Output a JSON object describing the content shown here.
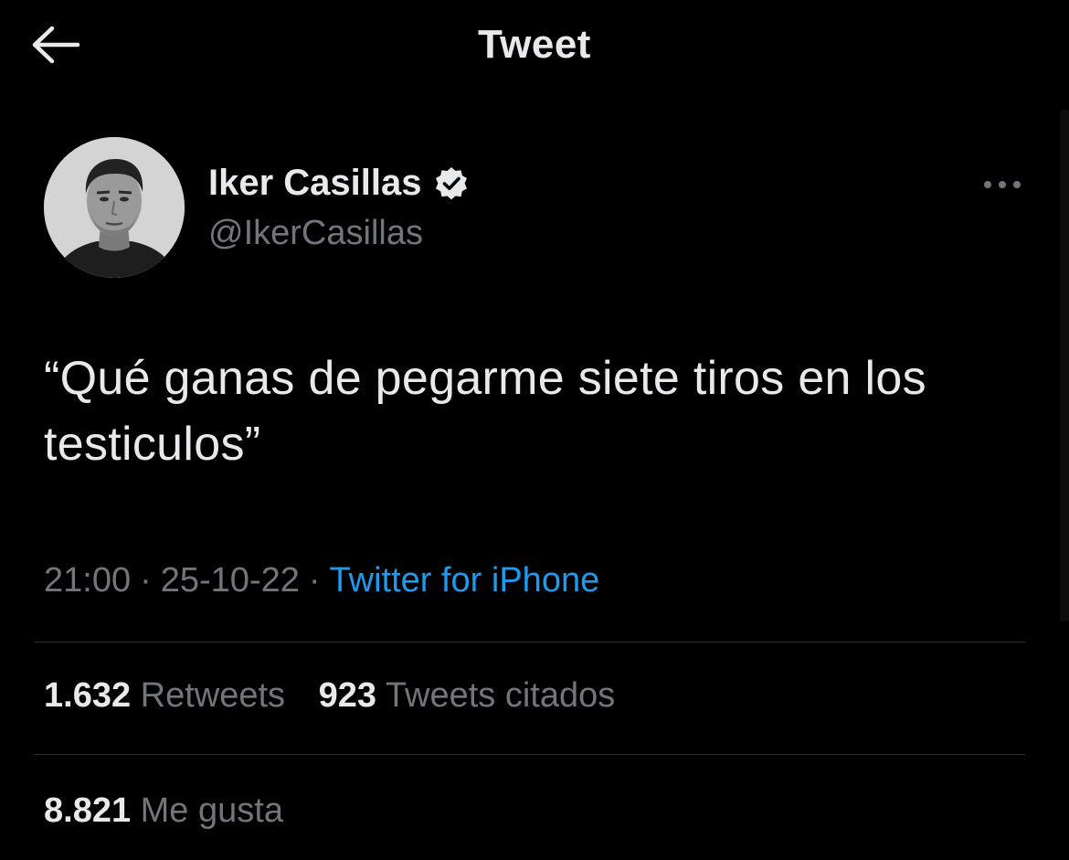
{
  "header": {
    "title": "Tweet",
    "back_icon": "arrow-left-icon"
  },
  "author": {
    "name": "Iker Casillas",
    "handle": "@IkerCasillas",
    "verified_icon": "verified-badge-icon",
    "more_icon": "more-horizontal-icon"
  },
  "tweet": {
    "text": "“Qué ganas de pegarme siete tiros en los testiculos”",
    "time": "21:00",
    "date": "25-10-22",
    "separator": "·",
    "source": "Twitter for iPhone"
  },
  "stats": {
    "retweets_count": "1.632",
    "retweets_label": "Retweets",
    "quotes_count": "923",
    "quotes_label": "Tweets citados",
    "likes_count": "8.821",
    "likes_label": "Me gusta"
  },
  "colors": {
    "background": "#000000",
    "text_primary": "#e7e9ea",
    "text_secondary": "#71767b",
    "link": "#1d9bf0",
    "divider": "#2f3336"
  }
}
